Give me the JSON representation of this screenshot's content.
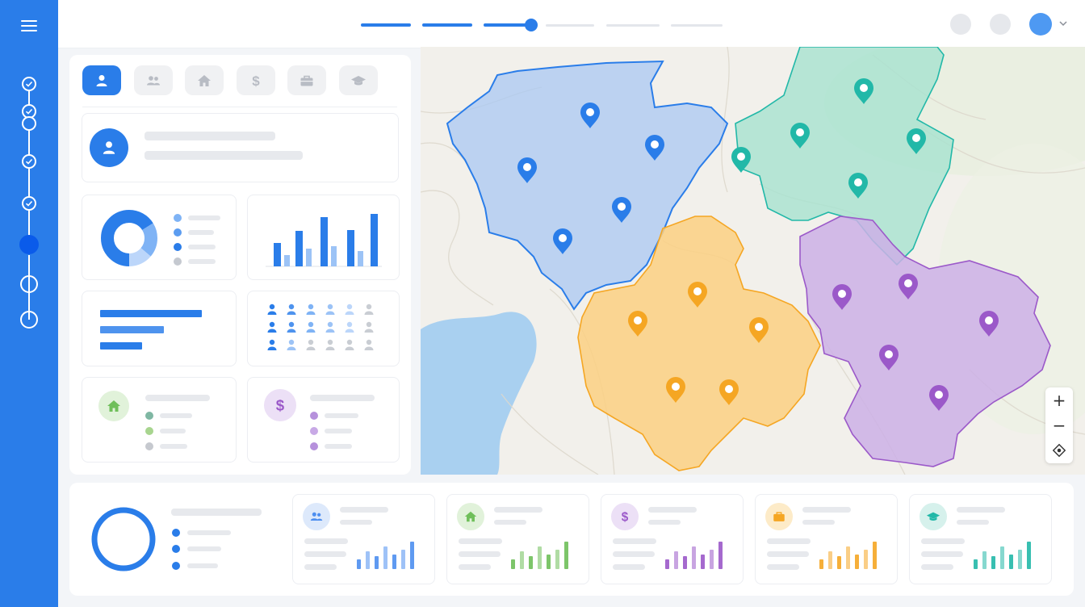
{
  "stepper": {
    "steps": [
      "done",
      "done",
      "done",
      "done",
      "done",
      "active",
      "todo",
      "todo"
    ]
  },
  "topbar": {
    "progress": {
      "completed_segments": 3,
      "total_segments": 6
    }
  },
  "category_tabs": [
    "person-icon",
    "group-icon",
    "home-icon",
    "dollar-icon",
    "briefcase-icon",
    "graduation-cap-icon"
  ],
  "active_tab": "person-icon",
  "map": {
    "regions": [
      {
        "name": "blue",
        "color": "#2a7de9",
        "fill": "#a9c8f3"
      },
      {
        "name": "teal",
        "color": "#22b8a8",
        "fill": "#a6e2d0"
      },
      {
        "name": "orange",
        "color": "#f5a623",
        "fill": "#fbd083"
      },
      {
        "name": "purple",
        "color": "#9b59c9",
        "fill": "#cdb0e6"
      }
    ],
    "controls": {
      "zoom_in": "+",
      "zoom_out": "−"
    }
  },
  "colors": {
    "primary": "#2a7de9",
    "green": "#7ccb6a",
    "purple": "#9b59c9",
    "orange": "#f5a623",
    "teal": "#22b8a8"
  },
  "bottom_kpis": [
    {
      "icon": "group-icon",
      "color": "#4e8ff0",
      "bg": "#dde9fb"
    },
    {
      "icon": "home-icon",
      "color": "#6fbf5a",
      "bg": "#e1f2da"
    },
    {
      "icon": "dollar-icon",
      "color": "#9b59c9",
      "bg": "#ece0f6"
    },
    {
      "icon": "briefcase-icon",
      "color": "#f5a623",
      "bg": "#fdebc8"
    },
    {
      "icon": "graduation-cap-icon",
      "color": "#22b8a8",
      "bg": "#d6f1ec"
    }
  ]
}
